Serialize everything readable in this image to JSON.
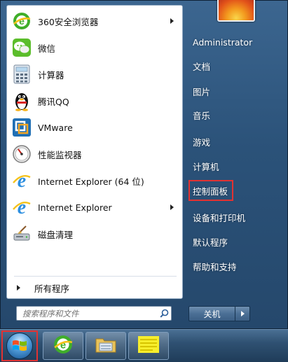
{
  "programs": [
    {
      "label": "360安全浏览器",
      "icon": "360-browser-icon",
      "has_submenu": true
    },
    {
      "label": "微信",
      "icon": "wechat-icon",
      "has_submenu": false
    },
    {
      "label": "计算器",
      "icon": "calculator-icon",
      "has_submenu": false
    },
    {
      "label": "腾讯QQ",
      "icon": "qq-penguin-icon",
      "has_submenu": false
    },
    {
      "label": "VMware",
      "icon": "vmware-icon",
      "has_submenu": false
    },
    {
      "label": "性能监视器",
      "icon": "performance-monitor-icon",
      "has_submenu": false
    },
    {
      "label": "Internet Explorer (64 位)",
      "icon": "internet-explorer-icon",
      "has_submenu": false
    },
    {
      "label": "Internet Explorer",
      "icon": "internet-explorer-icon",
      "has_submenu": true
    },
    {
      "label": "磁盘清理",
      "icon": "disk-cleanup-icon",
      "has_submenu": false
    }
  ],
  "all_programs": {
    "label": "所有程序"
  },
  "search": {
    "placeholder": "搜索程序和文件"
  },
  "right_pane": {
    "items": [
      {
        "label": "Administrator",
        "highlighted": false
      },
      {
        "label": "文档",
        "highlighted": false
      },
      {
        "label": "图片",
        "highlighted": false
      },
      {
        "label": "音乐",
        "highlighted": false
      },
      {
        "label": "游戏",
        "highlighted": false
      },
      {
        "label": "计算机",
        "highlighted": false
      },
      {
        "label": "控制面板",
        "highlighted": true
      },
      {
        "label": "设备和打印机",
        "highlighted": false
      },
      {
        "label": "默认程序",
        "highlighted": false
      },
      {
        "label": "帮助和支持",
        "highlighted": false
      }
    ],
    "shutdown_label": "关机"
  },
  "taskbar": {
    "pinned": [
      {
        "icon": "internet-explorer-icon"
      },
      {
        "icon": "file-explorer-icon"
      },
      {
        "icon": "notes-app-icon"
      }
    ]
  },
  "colors": {
    "highlight_border": "#e23232",
    "menu_blue": "#2b5279",
    "taskbar_blue": "#1f3c59"
  }
}
